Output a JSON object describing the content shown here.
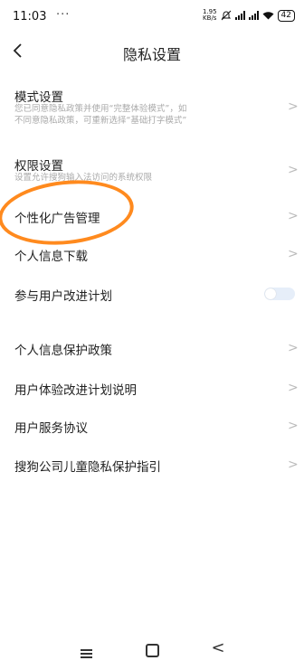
{
  "status_bar": {
    "time": "11:03",
    "dots": "···",
    "net_speed_value": "1.95",
    "net_speed_unit": "KB/s",
    "battery": "42"
  },
  "header": {
    "title": "隐私设置",
    "back_icon": "chevron-left-icon"
  },
  "items": [
    {
      "label": "模式设置",
      "desc_line1": "您已同意隐私政策并使用“完整体验模式”，如",
      "desc_line2": "不同意隐私政策，可重新选择“基础打字模式”",
      "chevron": ">"
    },
    {
      "label": "权限设置",
      "desc_line1": "设置允许搜狗输入法访问的系统权限",
      "chevron": ">"
    },
    {
      "label": "个性化广告管理",
      "chevron": ">"
    },
    {
      "label": "个人信息下载",
      "chevron": ">"
    },
    {
      "label": "参与用户改进计划",
      "toggle_on": false
    },
    {
      "label": "个人信息保护政策",
      "chevron": ">"
    },
    {
      "label": "用户体验改进计划说明",
      "chevron": ">"
    },
    {
      "label": "用户服务协议",
      "chevron": ">"
    },
    {
      "label": "搜狗公司儿童隐私保护指引",
      "chevron": ">"
    }
  ],
  "annotation_color": "#ff8a1e",
  "nav": {
    "recent_icon": "menu-icon",
    "home_icon": "square-icon",
    "back_icon": "triangle-back-icon",
    "back_glyph": "<"
  }
}
